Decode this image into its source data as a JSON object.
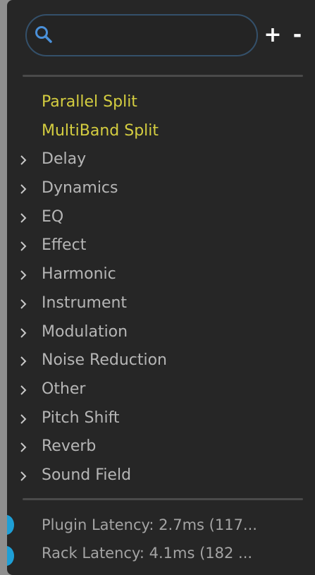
{
  "search": {
    "value": "",
    "placeholder": "",
    "add_label": "+",
    "remove_label": "-"
  },
  "menu": {
    "items": [
      {
        "label": "Parallel Split",
        "special": true
      },
      {
        "label": "MultiBand Split",
        "special": true
      },
      {
        "label": "Delay",
        "special": false
      },
      {
        "label": "Dynamics",
        "special": false
      },
      {
        "label": "EQ",
        "special": false
      },
      {
        "label": "Effect",
        "special": false
      },
      {
        "label": "Harmonic",
        "special": false
      },
      {
        "label": "Instrument",
        "special": false
      },
      {
        "label": "Modulation",
        "special": false
      },
      {
        "label": "Noise Reduction",
        "special": false
      },
      {
        "label": "Other",
        "special": false
      },
      {
        "label": "Pitch Shift",
        "special": false
      },
      {
        "label": "Reverb",
        "special": false
      },
      {
        "label": "Sound Field",
        "special": false
      }
    ]
  },
  "footer": {
    "plugin_latency": "Plugin Latency: 2.7ms (117...",
    "rack_latency": "Rack Latency: 4.1ms (182 ..."
  },
  "colors": {
    "panel_bg": "#262626",
    "special_text": "#d4cd40",
    "normal_text": "#b6b6b6",
    "search_border": "#34506a",
    "search_icon": "#4a90d9",
    "accent_dot": "#1e9fd6"
  }
}
